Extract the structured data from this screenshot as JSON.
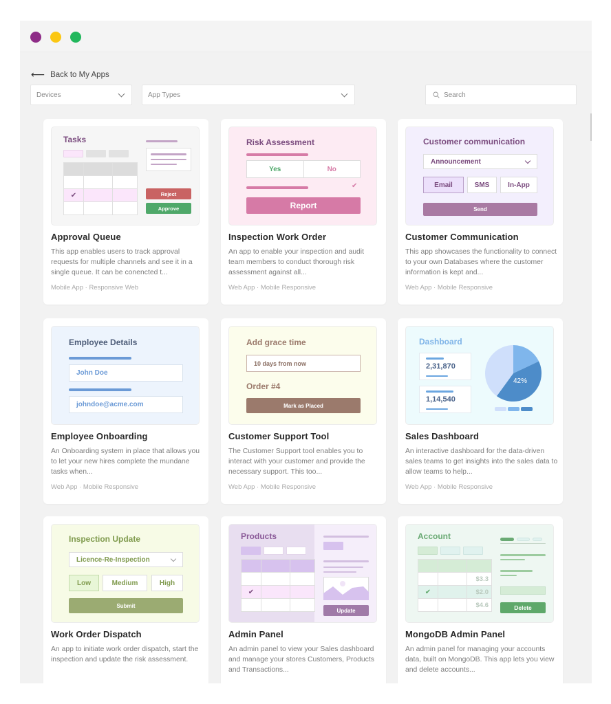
{
  "window": {
    "controls": [
      "close",
      "minimize",
      "maximize"
    ],
    "colors": {
      "close": "#8e2c87",
      "minimize": "#fbc713",
      "maximize": "#22b75c"
    }
  },
  "nav": {
    "back_icon": "arrow-left-icon",
    "back_label": "Back to My Apps"
  },
  "filters": {
    "devices": {
      "value": "Devices"
    },
    "app_types": {
      "value": "App Types"
    },
    "search": {
      "placeholder": "Search",
      "value": ""
    }
  },
  "cards": [
    {
      "title": "Approval Queue",
      "description": "This app enables users to track approval requests for multiple channels and see it in a single queue. It can be conencted t...",
      "tags": "Mobile App · Responsive Web",
      "preview": {
        "heading": "Tasks",
        "reject": "Reject",
        "approve": "Approve",
        "check": "✔"
      }
    },
    {
      "title": "Inspection Work Order",
      "description": "An app to enable your inspection and audit team members to conduct thorough risk assessment against all...",
      "tags": "Web App · Mobile Responsive",
      "preview": {
        "heading": "Risk Assessment",
        "yes": "Yes",
        "no": "No",
        "report": "Report",
        "check": "✔"
      }
    },
    {
      "title": "Customer Communication",
      "description": "This app showcases the functionality to connect to your own Databases where the customer information is kept and...",
      "tags": "Web App · Mobile Responsive",
      "preview": {
        "heading": "Customer communication",
        "dropdown": "Announcement",
        "channels": [
          "Email",
          "SMS",
          "In-App"
        ],
        "send": "Send"
      }
    },
    {
      "title": "Employee Onboarding",
      "description": "An Onboarding system in place that allows you to let your new hires complete the mundane tasks when...",
      "tags": "Web App · Mobile Responsive",
      "preview": {
        "heading": "Employee Details",
        "name": "John Doe",
        "email": "johndoe@acme.com"
      }
    },
    {
      "title": "Customer Support Tool",
      "description": "The Customer Support tool enables you to interact with your customer and provide the necessary support. This too...",
      "tags": "Web App · Mobile Responsive",
      "preview": {
        "heading": "Add grace time",
        "input": "10 days from now",
        "order": "Order #4",
        "action": "Mark as Placed"
      }
    },
    {
      "title": "Sales Dashboard",
      "description": "An interactive dashboard for the data-driven sales teams to get insights into the sales data to allow teams to help...",
      "tags": "Web App · Mobile Responsive",
      "preview": {
        "heading": "Dashboard",
        "stat1": "2,31,870",
        "stat2": "1,14,540",
        "pie_label": "42%",
        "pie_slices": [
          0.42,
          0.18,
          0.4
        ]
      }
    },
    {
      "title": "Work Order Dispatch",
      "description": "An app to initiate work order dispatch, start the inspection and update the risk assessment.",
      "tags": "",
      "preview": {
        "heading": "Inspection Update",
        "dropdown": "Licence-Re-Inspection",
        "levels": [
          "Low",
          "Medium",
          "High"
        ],
        "submit": "Submit"
      }
    },
    {
      "title": "Admin Panel",
      "description": "An admin panel to view your Sales dashboard and manage your stores Customers, Products and Transactions...",
      "tags": "",
      "preview": {
        "heading": "Products",
        "update": "Update",
        "check": "✔"
      }
    },
    {
      "title": "MongoDB Admin Panel",
      "description": "An admin panel for managing your accounts data, built on MongoDB. This app lets you view and delete accounts...",
      "tags": "",
      "preview": {
        "heading": "Account",
        "amounts": [
          "$3.3",
          "$2.0",
          "$4.6"
        ],
        "delete": "Delete",
        "check": "✔"
      }
    }
  ]
}
